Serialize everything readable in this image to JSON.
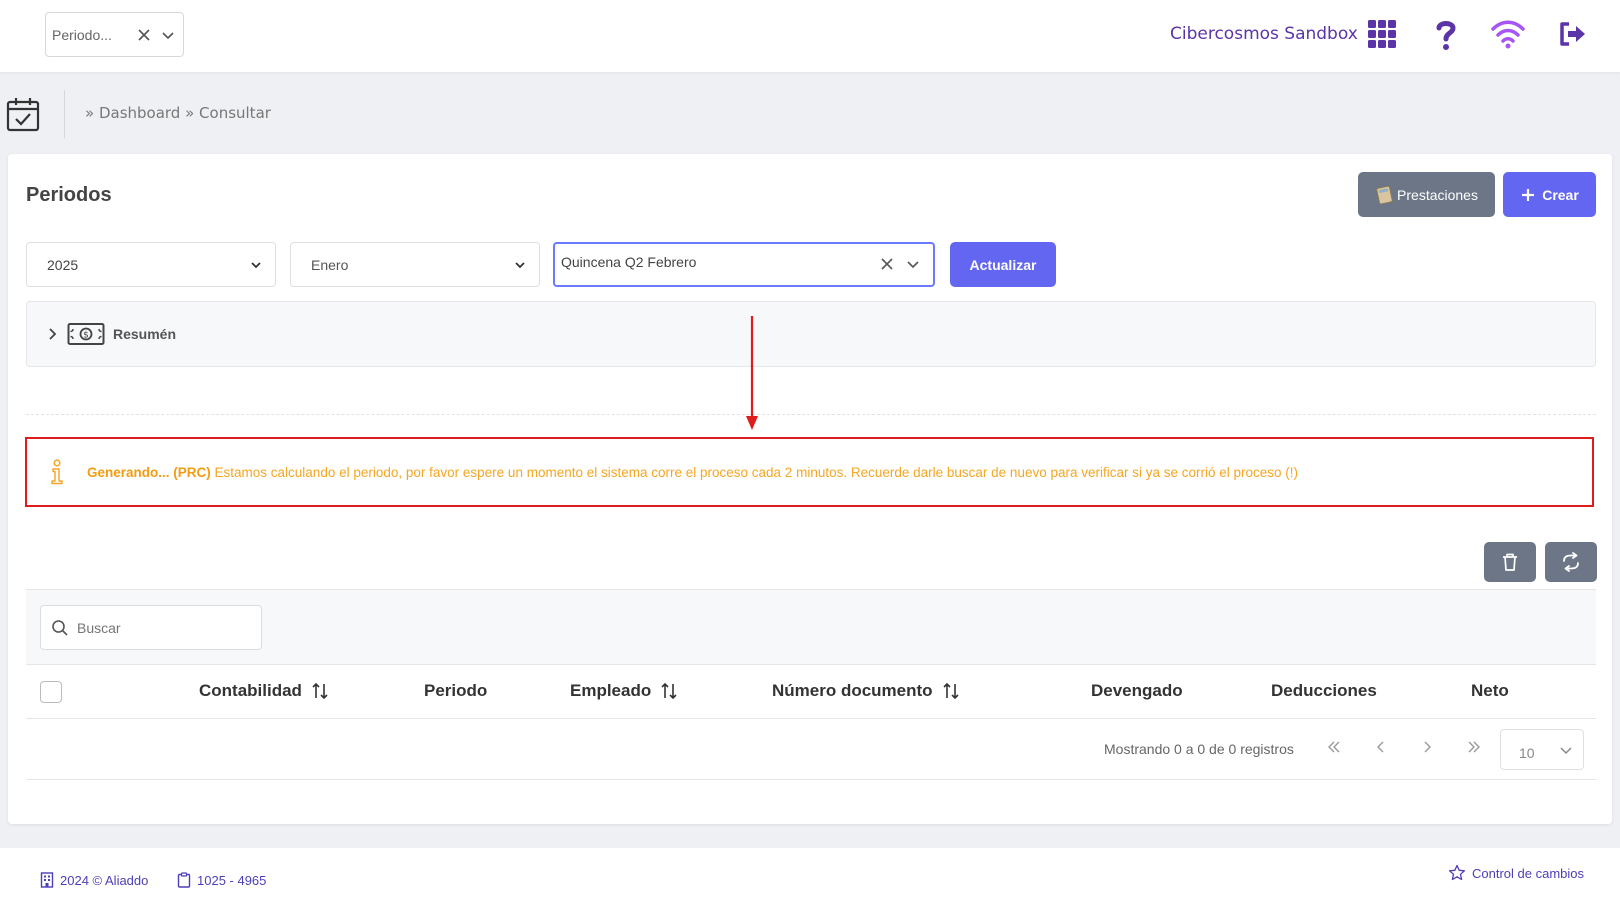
{
  "topbar": {
    "period_select": "Periodo...",
    "brand": "Cibercosmos Sandbox"
  },
  "breadcrumb": "» Dashboard » Consultar",
  "page": {
    "title": "Periodos",
    "btn_prestaciones": "Prestaciones",
    "btn_crear": "Crear",
    "btn_actualizar": "Actualizar"
  },
  "filters": {
    "year": "2025",
    "month": "Enero",
    "quincena": "Quincena Q2 Febrero"
  },
  "resumen": "Resumén",
  "alert": {
    "strong": "Generando... (PRC)",
    "message": " Estamos calculando el periodo, por favor espere un momento el sistema corre el proceso cada 2 minutos. Recuerde darle buscar de nuevo para verificar si ya se corrió el proceso (!)"
  },
  "table": {
    "search_placeholder": "Buscar",
    "columns": [
      "Contabilidad",
      "Periodo",
      "Empleado",
      "Número documento",
      "Devengado",
      "Deducciones",
      "Neto"
    ],
    "info": "Mostrando 0 a 0 de 0 registros",
    "page_size": "10"
  },
  "footer": {
    "copyright": "2024 © Aliaddo",
    "version": "1025 - 4965",
    "changes": "Control de cambios"
  },
  "colors": {
    "accent": "#6366f1",
    "brand": "#5b35a8",
    "alert_border": "#e01b1b",
    "warning": "#f5a623"
  }
}
